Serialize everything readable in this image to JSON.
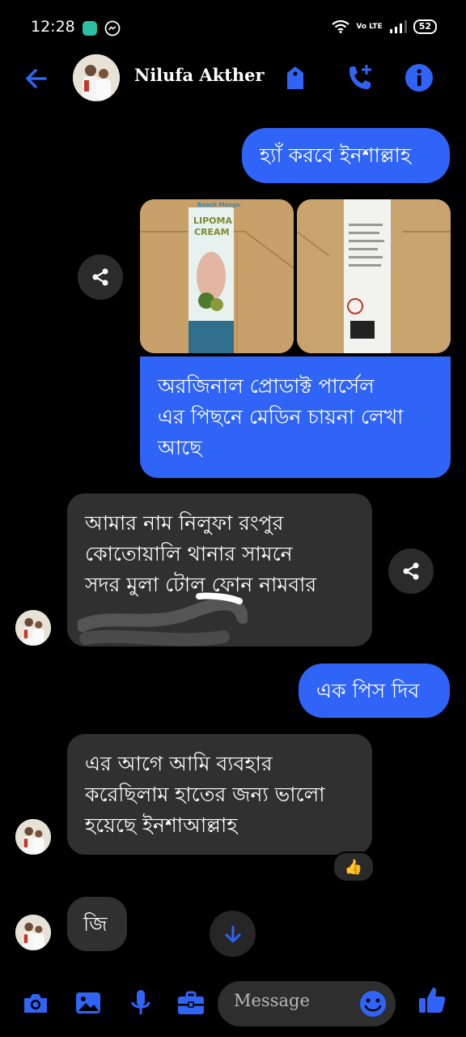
{
  "status_bar": {
    "time": "12:28",
    "battery": "52",
    "network_label": "Vo LTE"
  },
  "header": {
    "contact_name": "Nilufa Akther"
  },
  "messages": [
    {
      "id": "m1",
      "direction": "outgoing",
      "text": "হ্যাঁ করবে ইনশাল্লাহ"
    },
    {
      "id": "m2",
      "direction": "outgoing",
      "type": "photos",
      "photo_texts": [
        "Beach Mango",
        "LIPOMA",
        "CREAM"
      ]
    },
    {
      "id": "m3",
      "direction": "outgoing",
      "lines": [
        "অরজিনাল প্রোডাক্ট পার্সেল",
        "এর পিছনে মেডিন চায়না লেখা",
        "আছে"
      ]
    },
    {
      "id": "m4",
      "direction": "incoming",
      "lines": [
        "আমার নাম নিলুফা রংপুর",
        "কোতোয়ালি থানার সামনে",
        "সদর মুলা টোল ফোন নামবার"
      ]
    },
    {
      "id": "m5",
      "direction": "outgoing",
      "text": "এক পিস দিব"
    },
    {
      "id": "m6",
      "direction": "incoming",
      "lines": [
        "এর আগে আমি ব্যবহার",
        "করেছিলাম হাতের জন্য ভালো",
        "হয়েছে ইনশাআল্লাহ"
      ],
      "reaction": "👍"
    },
    {
      "id": "m7",
      "direction": "incoming",
      "text": "জি"
    }
  ],
  "composer": {
    "placeholder": "Message"
  },
  "colors": {
    "accent": "#2f64f6",
    "incoming_bubble": "#303030",
    "background": "#000000"
  }
}
